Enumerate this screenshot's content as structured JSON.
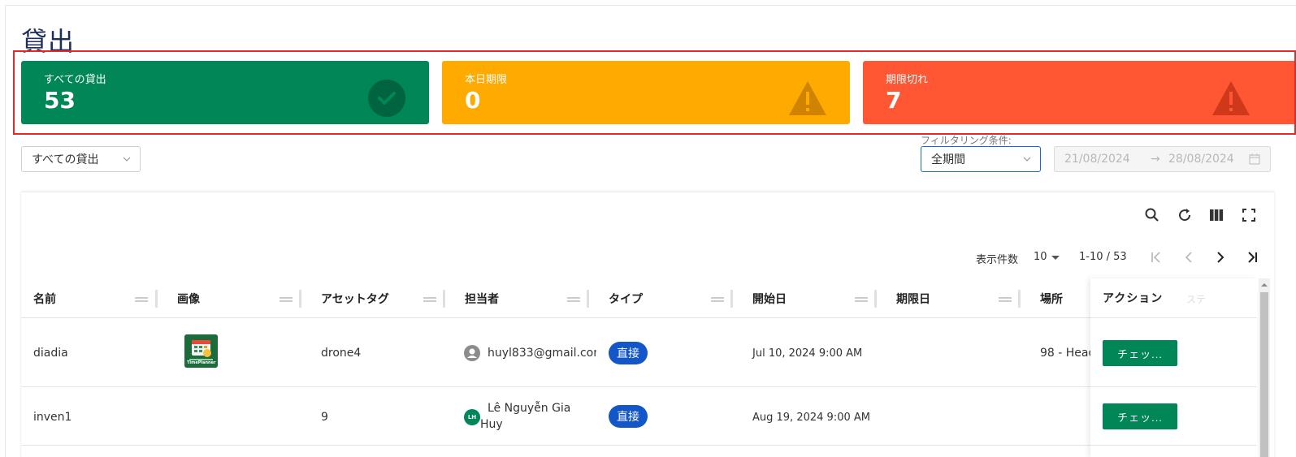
{
  "page": {
    "title": "貸出"
  },
  "stats": [
    {
      "label": "すべての貸出",
      "value": "53",
      "color": "#008657",
      "icon": "check-circle-icon"
    },
    {
      "label": "本日期限",
      "value": "0",
      "color": "#ffaa00",
      "icon": "warning-icon"
    },
    {
      "label": "期限切れ",
      "value": "7",
      "color": "#ff5733",
      "icon": "warning-icon"
    }
  ],
  "filters": {
    "main_select": "すべての貸出",
    "filter_label": "フィルタリング条件:",
    "period_select": "全期間",
    "date_from": "21/08/2024",
    "date_arrow": "→",
    "date_to": "28/08/2024"
  },
  "pagination": {
    "rows_label": "表示件数",
    "rows_per_page": "10",
    "range": "1-10 / 53"
  },
  "table": {
    "columns": [
      "名前",
      "画像",
      "アセットタグ",
      "担当者",
      "タイプ",
      "開始日",
      "期限日",
      "場所",
      "アクション",
      "ステ"
    ],
    "rows": [
      {
        "name": "diadia",
        "asset_tag": "drone4",
        "assignee": "huyl833@gmail.com",
        "type": "直接",
        "start_date": "Jul 10, 2024 9:00 AM",
        "due_date": "",
        "location": "98 - Head",
        "action": "チェッ..."
      },
      {
        "name": "inven1",
        "asset_tag": "9",
        "assignee_initials": "LH",
        "assignee_line1": "Lê Nguyễn Gia",
        "assignee_line2": "Huy",
        "type": "直接",
        "start_date": "Aug 19, 2024 9:00 AM",
        "due_date": "",
        "location": "",
        "action": "チェッ..."
      }
    ]
  },
  "image_caption": "TimePlanner"
}
